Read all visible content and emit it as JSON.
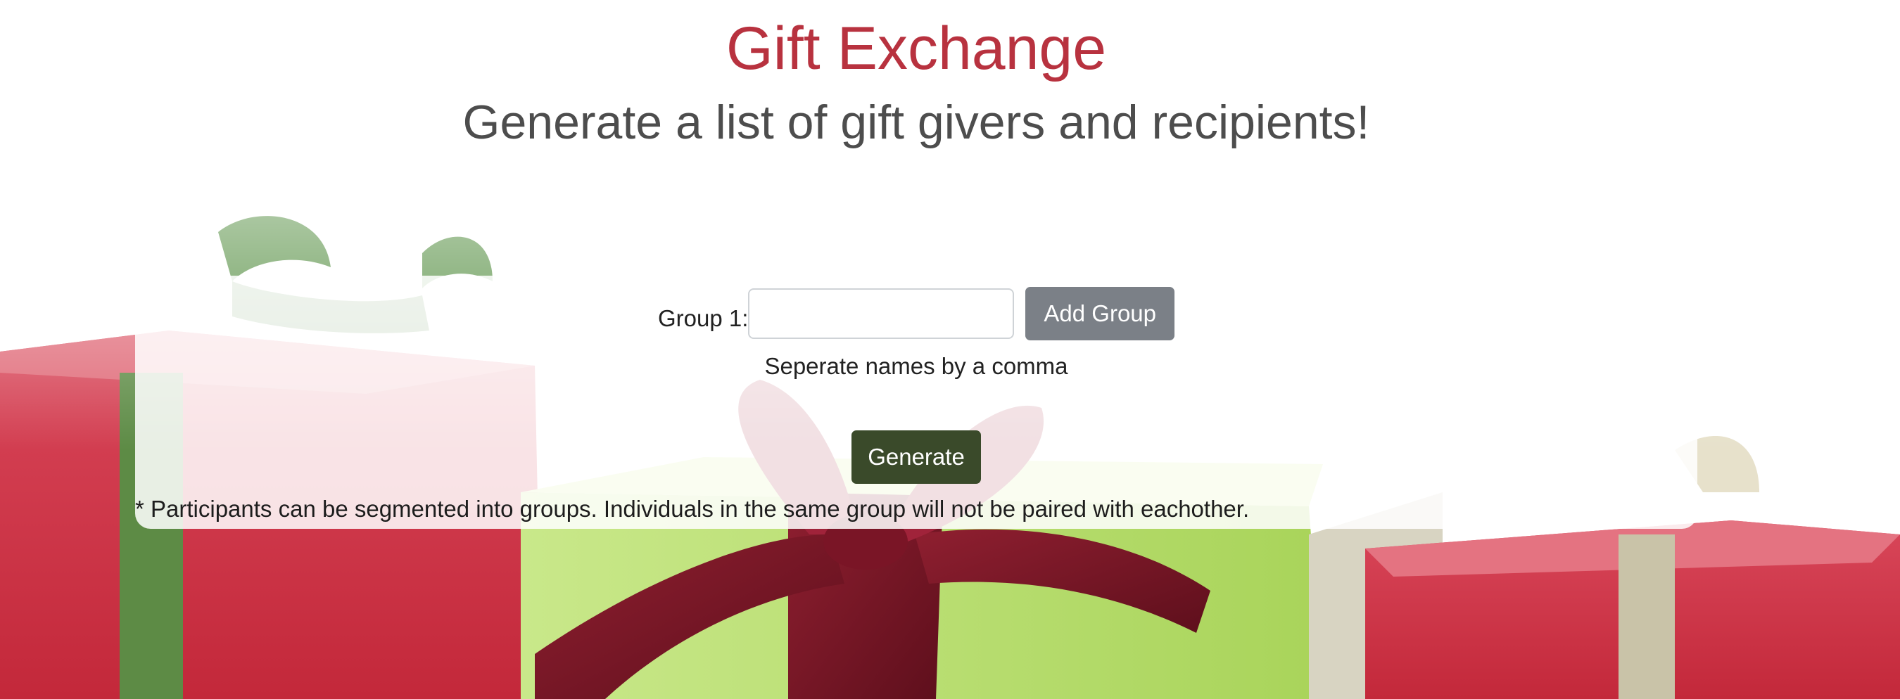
{
  "header": {
    "title": "Gift Exchange",
    "subtitle": "Generate a list of gift givers and recipients!"
  },
  "form": {
    "group_label": "Group 1:",
    "group_input_value": "",
    "add_group_label": "Add Group",
    "hint": "Seperate names by a comma",
    "generate_label": "Generate",
    "footnote": "* Participants can be segmented into groups. Individuals in the same group will not be paired with eachother."
  },
  "colors": {
    "title": "#b8323f",
    "subtitle": "#4d4d4d",
    "add_group_button": "#7b8087",
    "generate_button": "#3a4a2a"
  }
}
